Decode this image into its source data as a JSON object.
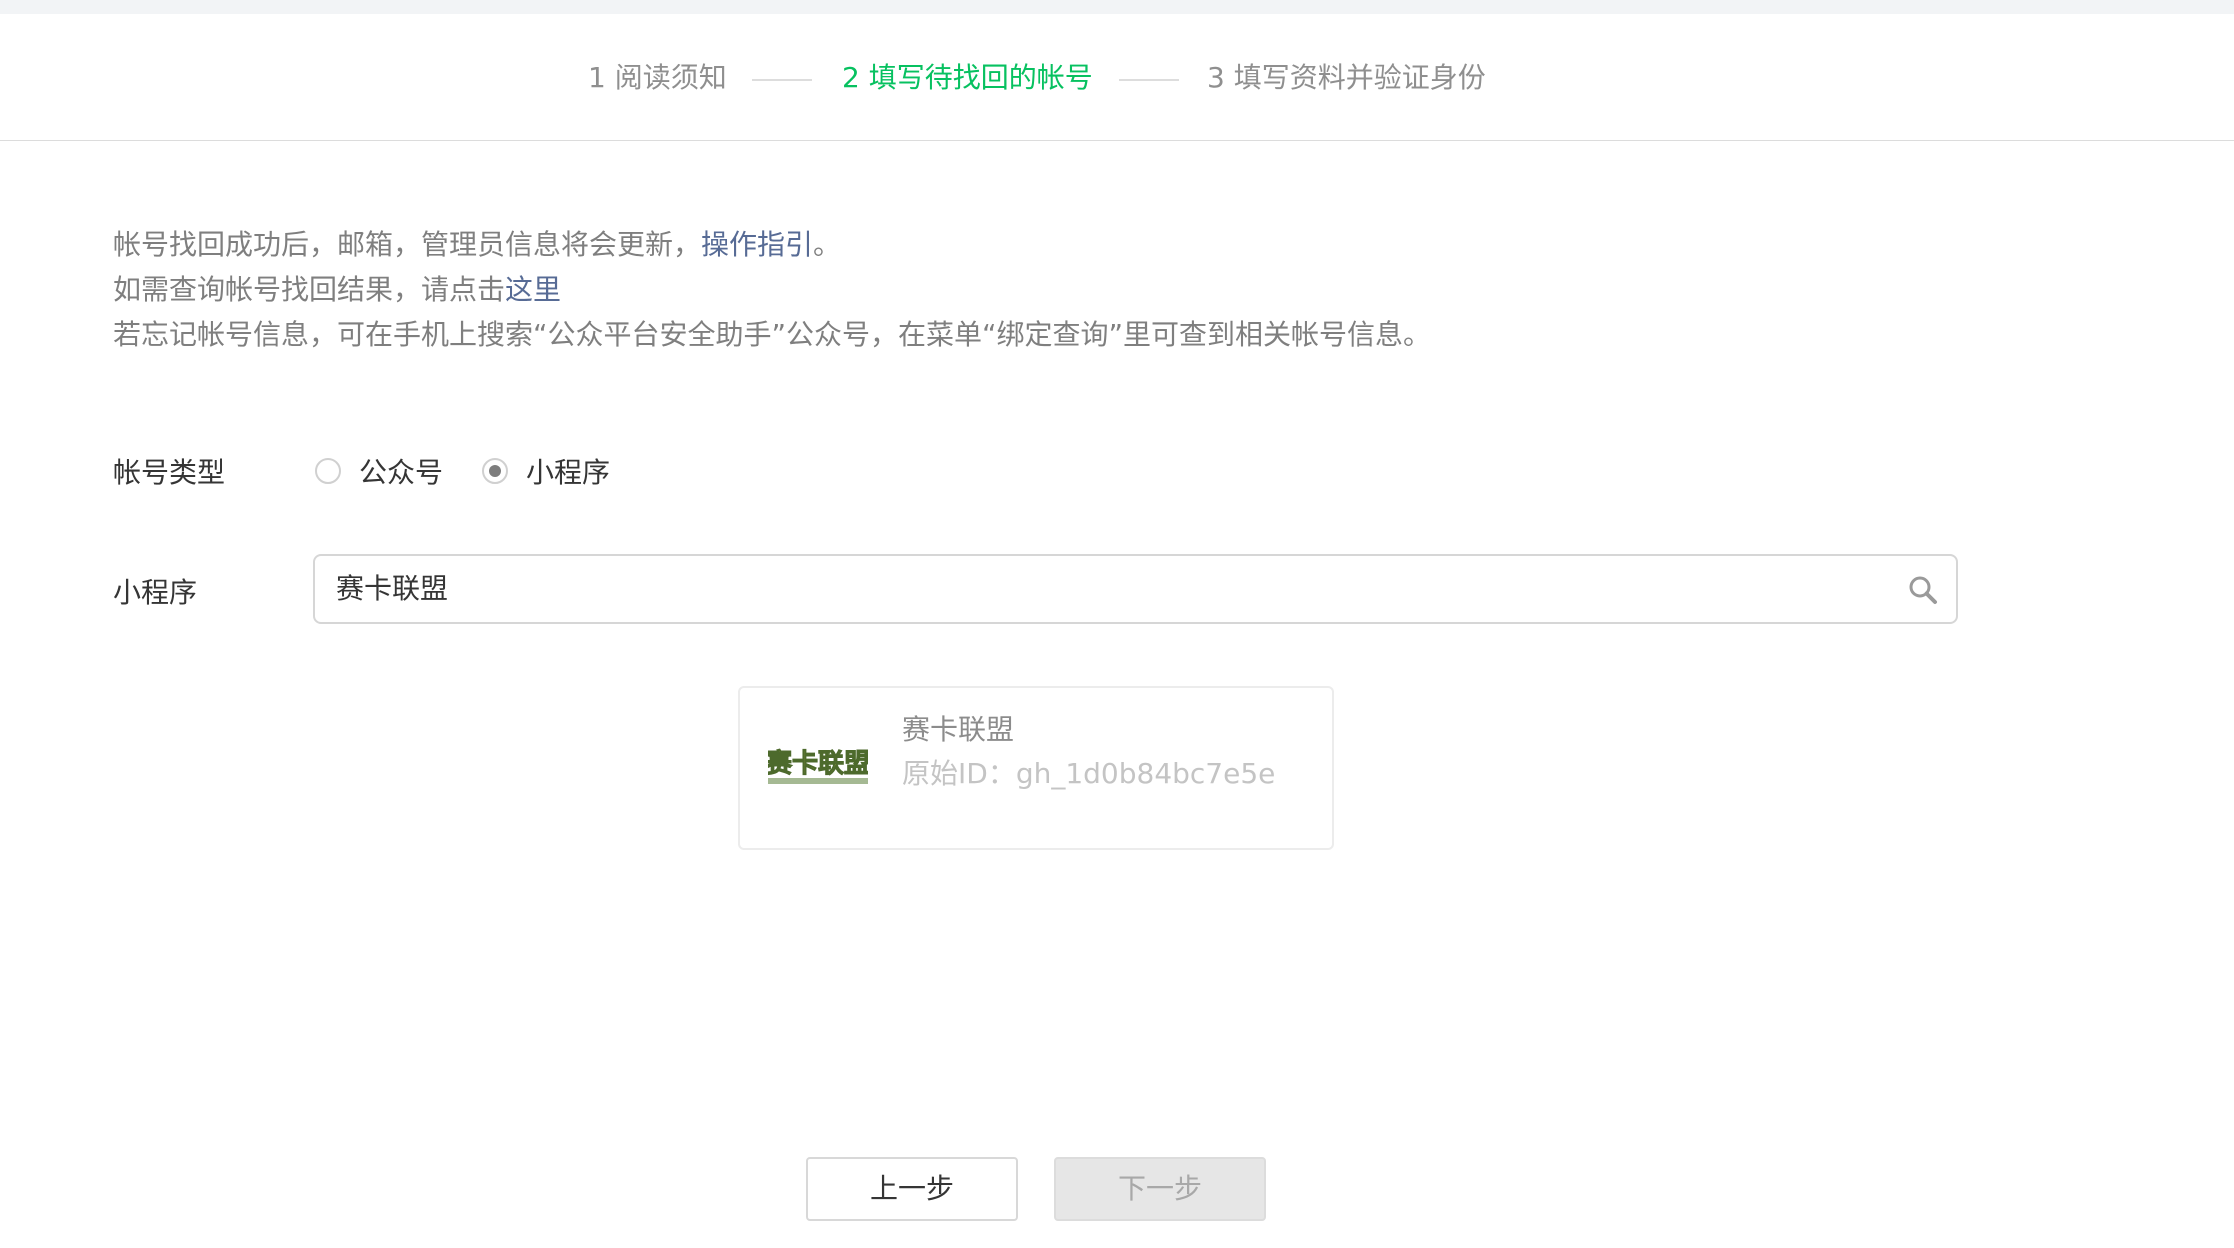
{
  "steps": [
    {
      "label": "1 阅读须知",
      "state": "done"
    },
    {
      "label": "2 填写待找回的帐号",
      "state": "active"
    },
    {
      "label": "3 填写资料并验证身份",
      "state": "pending"
    }
  ],
  "notice": {
    "line1_text": "帐号找回成功后，邮箱，管理员信息将会更新，",
    "line1_link": "操作指引",
    "line1_end": "。",
    "line2_text": "如需查询帐号找回结果，请点击",
    "line2_link": "这里",
    "line3_text": "若忘记帐号信息，可在手机上搜索“公众平台安全助手”公众号，在菜单“绑定查询”里可查到相关帐号信息。"
  },
  "form": {
    "account_type_label": "帐号类型",
    "options": [
      {
        "label": "公众号",
        "selected": false
      },
      {
        "label": "小程序",
        "selected": true
      }
    ],
    "miniprogram_label": "小程序",
    "search_value": "赛卡联盟"
  },
  "result": {
    "logo_text": "赛卡联盟",
    "name": "赛卡联盟",
    "original_id": "原始ID：gh_1d0b84bc7e5e"
  },
  "buttons": {
    "prev": "上一步",
    "next": "下一步"
  },
  "colors": {
    "accent": "#07c160",
    "link": "#576b95",
    "muted": "#7f7f7f"
  }
}
